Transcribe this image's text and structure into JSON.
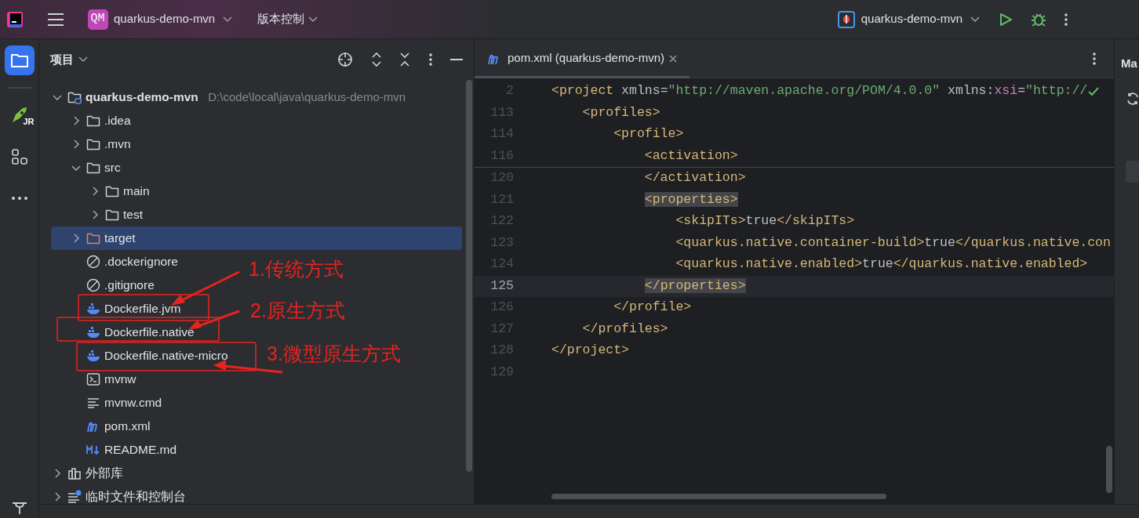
{
  "title_bar": {
    "project_badge": "QM",
    "project": "quarkus-demo-mvn",
    "vcs": "版本控制",
    "run_config": "quarkus-demo-mvn"
  },
  "tool_strip": [
    {
      "kind": "project",
      "selected": true
    },
    {
      "kind": "jrebel",
      "label": "JR",
      "selected": false
    },
    {
      "kind": "structure",
      "selected": false
    },
    {
      "kind": "more",
      "selected": false
    },
    {
      "kind": "build",
      "selected": false
    }
  ],
  "project_panel": {
    "title": "项目",
    "tree": [
      {
        "label": "quarkus-demo-mvn",
        "path": "D:\\code\\local\\java\\quarkus-demo-mvn",
        "kind": "module",
        "expanded": true,
        "selected": false,
        "children": [
          {
            "label": ".idea",
            "kind": "folder",
            "expanded": false,
            "selected": false
          },
          {
            "label": ".mvn",
            "kind": "folder",
            "expanded": false,
            "selected": false
          },
          {
            "label": "src",
            "kind": "folder",
            "expanded": true,
            "selected": false,
            "children": [
              {
                "label": "main",
                "kind": "folder",
                "expanded": false,
                "selected": false
              },
              {
                "label": "test",
                "kind": "folder",
                "expanded": false,
                "selected": false
              }
            ]
          },
          {
            "label": "target",
            "kind": "excluded-folder",
            "expanded": false,
            "selected": true
          },
          {
            "label": ".dockerignore",
            "kind": "ignore",
            "selected": false
          },
          {
            "label": ".gitignore",
            "kind": "ignore",
            "selected": false
          },
          {
            "label": "Dockerfile.jvm",
            "kind": "docker",
            "selected": false
          },
          {
            "label": "Dockerfile.native",
            "kind": "docker",
            "selected": false
          },
          {
            "label": "Dockerfile.native-micro",
            "kind": "docker",
            "selected": false
          },
          {
            "label": "mvnw",
            "kind": "terminal",
            "selected": false
          },
          {
            "label": "mvnw.cmd",
            "kind": "text",
            "selected": false
          },
          {
            "label": "pom.xml",
            "kind": "maven",
            "selected": false
          },
          {
            "label": "README.md",
            "kind": "markdown",
            "selected": false
          }
        ]
      },
      {
        "label": "外部库",
        "kind": "library",
        "expanded": false,
        "selected": false
      },
      {
        "label": "临时文件和控制台",
        "kind": "scratches",
        "expanded": false,
        "selected": false
      }
    ]
  },
  "annotations": [
    {
      "label": "1.传统方式"
    },
    {
      "label": "2.原生方式"
    },
    {
      "label": "3.微型原生方式"
    }
  ],
  "editor": {
    "tabs": [
      {
        "label": "pom.xml (quarkus-demo-mvn)",
        "selected": true
      }
    ],
    "sticky_lines": [
      {
        "number": "2",
        "tokens": [
          {
            "kind": "tag",
            "text": "<project"
          },
          {
            "kind": "attr",
            "text": " xmlns"
          },
          {
            "kind": "text",
            "text": "="
          },
          {
            "kind": "value",
            "text": "\"http://maven.apache.org/POM/4.0.0\""
          },
          {
            "kind": "attr",
            "text": " xmlns:"
          },
          {
            "kind": "ns",
            "text": "xsi"
          },
          {
            "kind": "text",
            "text": "="
          },
          {
            "kind": "value",
            "text": "\"http://"
          }
        ]
      },
      {
        "number": "113",
        "tokens": [
          {
            "kind": "tag",
            "text": "    <profiles>"
          }
        ]
      },
      {
        "number": "114",
        "tokens": [
          {
            "kind": "tag",
            "text": "        <profile>"
          }
        ]
      },
      {
        "number": "116",
        "tokens": [
          {
            "kind": "tag",
            "text": "            <activation>"
          }
        ]
      }
    ],
    "lines": [
      {
        "number": "120",
        "current": false,
        "tokens": [
          {
            "kind": "tag",
            "text": "            </activation>"
          }
        ]
      },
      {
        "number": "121",
        "current": false,
        "tokens": [
          {
            "kind": "matched-tag",
            "text": "            <properties>"
          }
        ]
      },
      {
        "number": "122",
        "current": false,
        "tokens": [
          {
            "kind": "tag",
            "text": "                <skipITs>"
          },
          {
            "kind": "text",
            "text": "true"
          },
          {
            "kind": "tag",
            "text": "</skipITs>"
          }
        ]
      },
      {
        "number": "123",
        "current": false,
        "tokens": [
          {
            "kind": "tag",
            "text": "                <quarkus.native.container-build>"
          },
          {
            "kind": "text",
            "text": "true"
          },
          {
            "kind": "tag",
            "text": "</quarkus.native.con"
          }
        ]
      },
      {
        "number": "124",
        "current": false,
        "tokens": [
          {
            "kind": "tag",
            "text": "                <quarkus.native.enabled>"
          },
          {
            "kind": "text",
            "text": "true"
          },
          {
            "kind": "tag",
            "text": "</quarkus.native.enabled>"
          }
        ]
      },
      {
        "number": "125",
        "current": true,
        "tokens": [
          {
            "kind": "matched-tag",
            "text": "            </properties>"
          }
        ]
      },
      {
        "number": "126",
        "current": false,
        "tokens": [
          {
            "kind": "tag",
            "text": "        </profile>"
          }
        ]
      },
      {
        "number": "127",
        "current": false,
        "tokens": [
          {
            "kind": "tag",
            "text": "    </profiles>"
          }
        ]
      },
      {
        "number": "128",
        "current": false,
        "tokens": [
          {
            "kind": "tag",
            "text": "</project>"
          }
        ]
      },
      {
        "number": "129",
        "current": false
      }
    ]
  },
  "right_panel": {
    "title": "Ma"
  }
}
